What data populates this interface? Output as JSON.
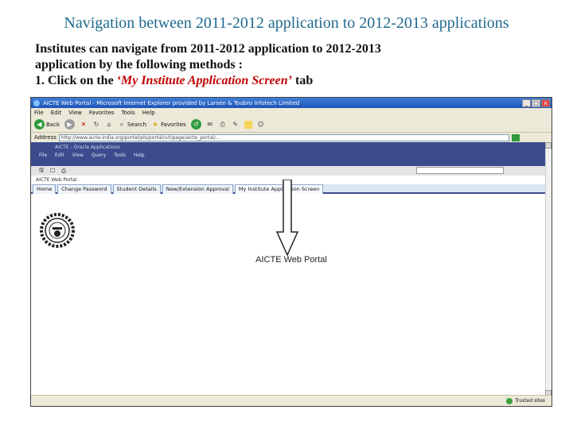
{
  "slide": {
    "title": "Navigation between 2011-2012 application to 2012-2013  applications",
    "line1": "Institutes can navigate from 2011-2012 application to 2012-2013",
    "line2": "application by the following methods :",
    "line3_prefix": "1. Click on the ",
    "line3_highlight": "‘My Institute Application Screen’",
    "line3_suffix": " tab"
  },
  "browser": {
    "title": "AICTE Web Portal - Microsoft Internet Explorer provided by Larsen & Toubro Infotech Limited",
    "win_buttons": [
      "_",
      "□",
      "x"
    ],
    "menu": [
      "File",
      "Edit",
      "View",
      "Favorites",
      "Tools",
      "Help"
    ],
    "toolbar": {
      "back": "Back",
      "search": "Search",
      "favorites": "Favorites"
    },
    "address_label": "Address",
    "address_value": "http://www.aicte-india.org/portal/pls/portal/url/page/aicte_portal/...",
    "status_zone": "Trusted sites"
  },
  "app": {
    "title": "AICTE - Oracle Applications",
    "menu": [
      "File",
      "Edit",
      "View",
      "Query",
      "Tools",
      "Help"
    ],
    "frame_label": "AICTE Web Portal",
    "tabs": [
      "Home",
      "Change Password",
      "Student Details",
      "New/Extension Approval",
      "My Institute Application Screen"
    ],
    "portal_name": "AICTE Web Portal"
  }
}
